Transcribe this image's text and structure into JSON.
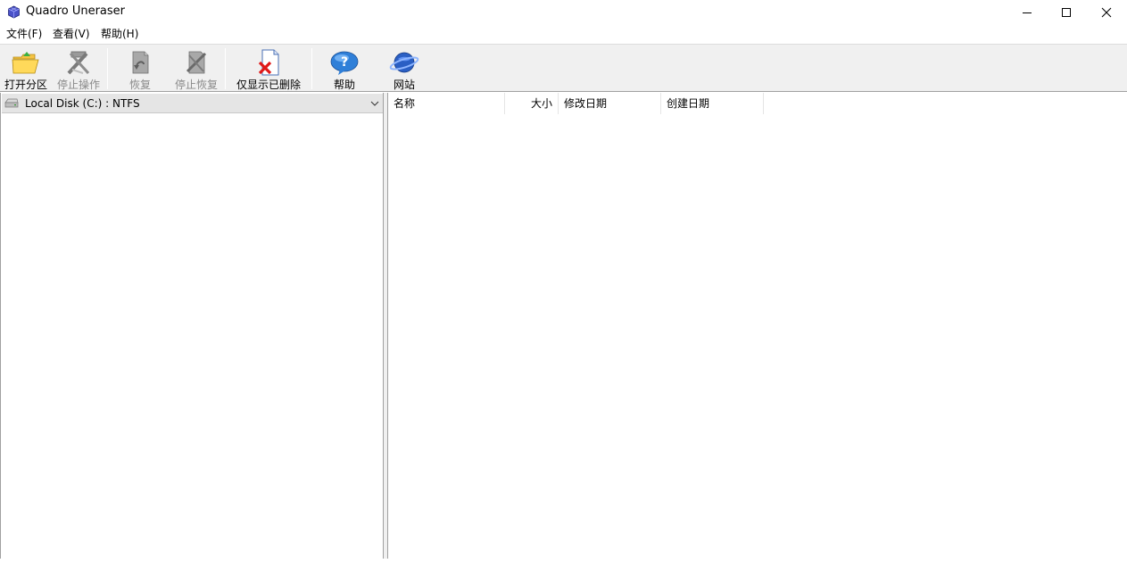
{
  "window": {
    "title": "Quadro Uneraser"
  },
  "menu": {
    "items": [
      "文件(F)",
      "查看(V)",
      "帮助(H)"
    ]
  },
  "toolbar": {
    "open_partition": "打开分区",
    "stop_operation": "停止操作",
    "restore": "恢复",
    "stop_restore": "停止恢复",
    "show_deleted_only": "仅显示已删除",
    "help": "帮助",
    "website": "网站"
  },
  "drive_selector": {
    "value": "Local Disk (C:) : NTFS"
  },
  "file_list": {
    "columns": [
      "名称",
      "大小",
      "修改日期",
      "创建日期"
    ],
    "rows": []
  },
  "colors": {
    "toolbar_bg": "#f0f0f0",
    "disabled_text": "#8a8a8a",
    "border": "#a0a0a0"
  }
}
